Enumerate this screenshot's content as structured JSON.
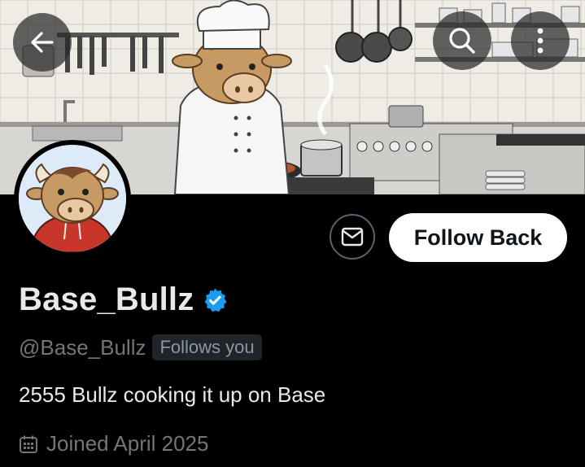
{
  "header": {
    "back_icon": "arrow-left-icon",
    "search_icon": "search-icon",
    "more_icon": "more-vertical-icon"
  },
  "profile": {
    "display_name": "Base_Bullz",
    "verified_icon": "verified-badge-icon",
    "handle": "@Base_Bullz",
    "follows_badge": "Follows you",
    "bio": "2555 Bullz cooking it up on Base",
    "joined_icon": "calendar-icon",
    "joined": "Joined April 2025"
  },
  "actions": {
    "message_icon": "mail-icon",
    "follow_label": "Follow Back"
  },
  "colors": {
    "background": "#000000",
    "primary_text": "#e7e9ea",
    "secondary_text": "#71767b",
    "verified_blue": "#1d9bf0",
    "follow_button_bg": "#ffffff"
  }
}
